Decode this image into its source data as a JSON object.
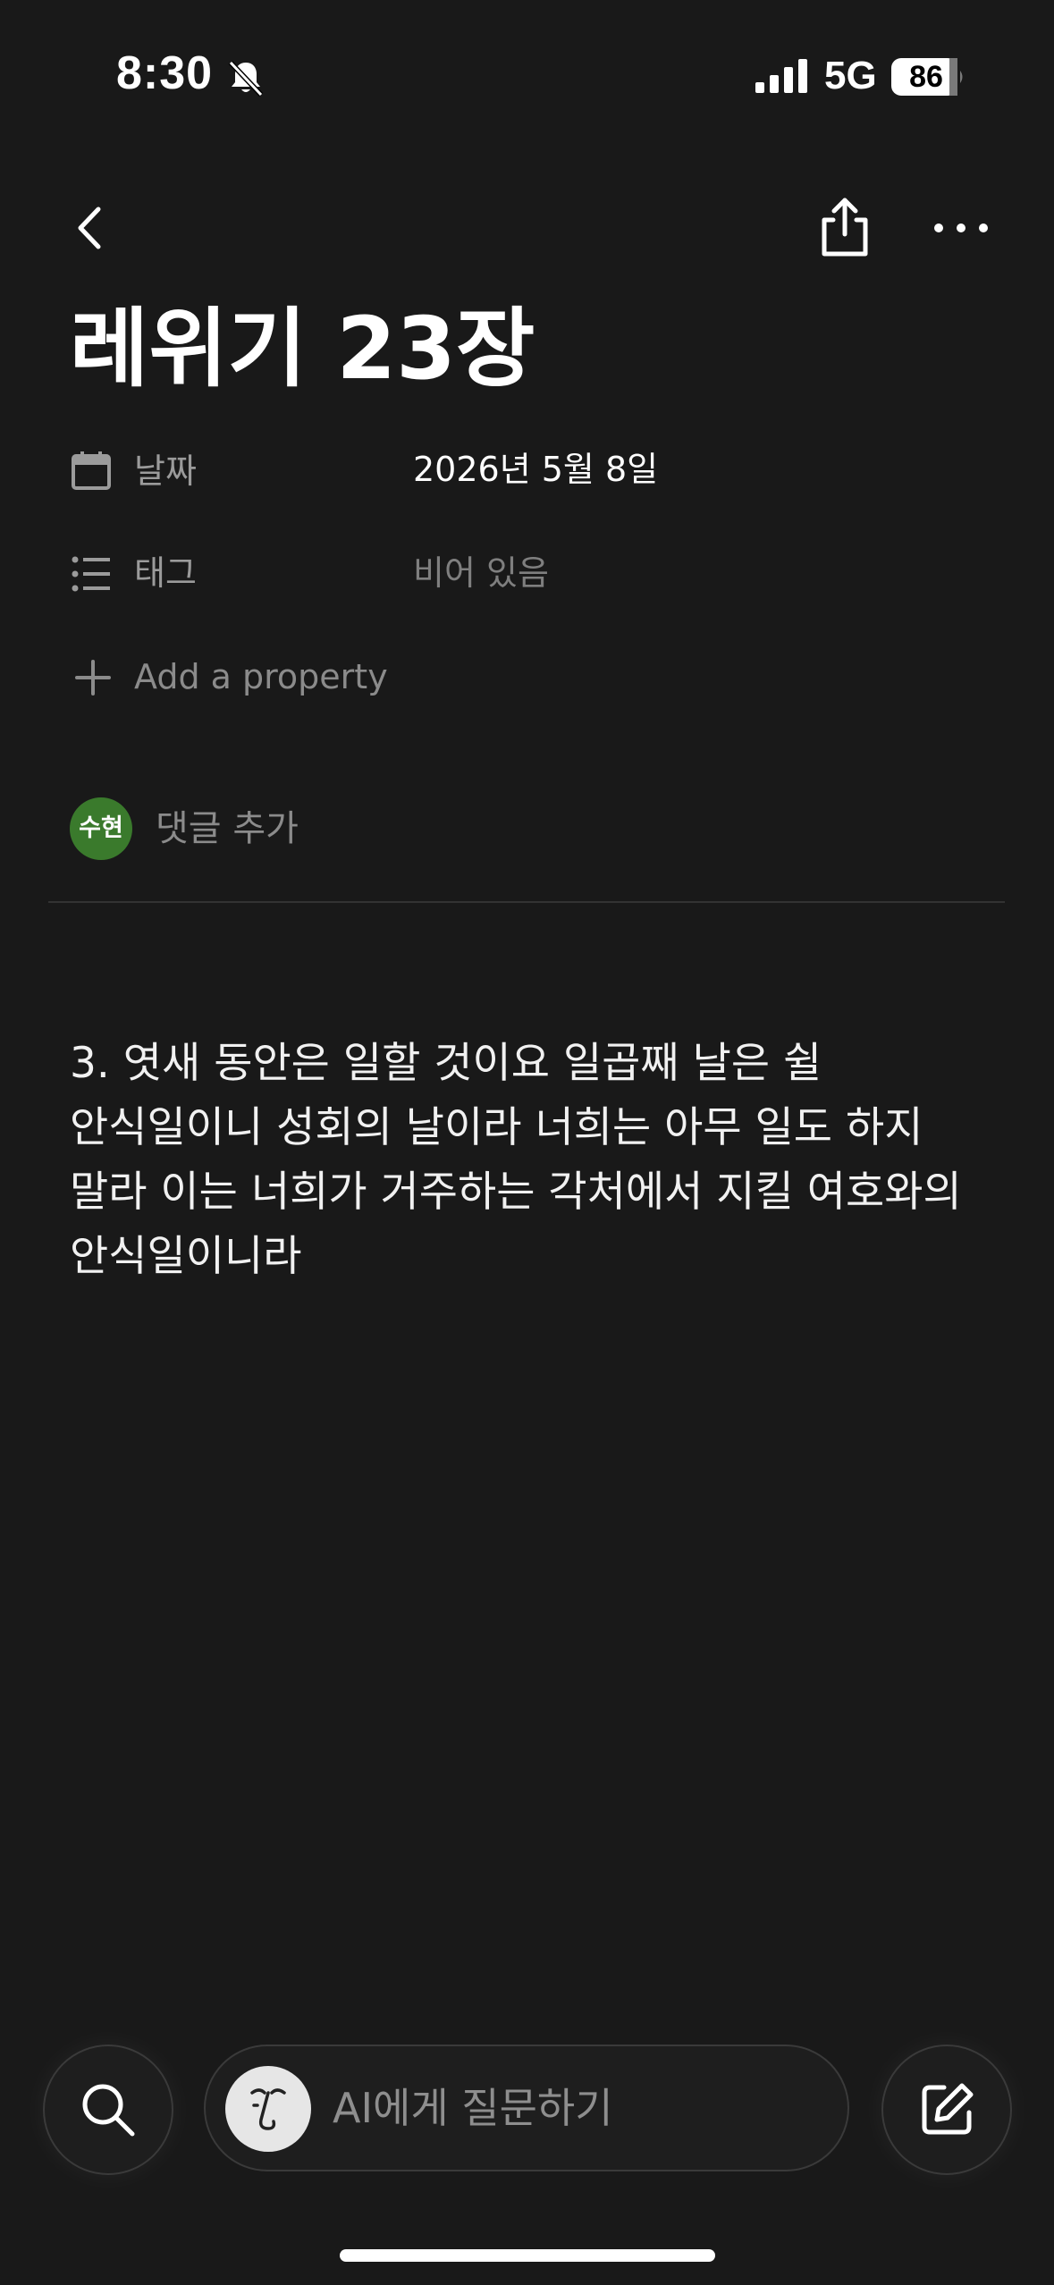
{
  "status_bar": {
    "time": "8:30",
    "network": "5G",
    "battery": "86",
    "icons": [
      "bell-slash-icon",
      "cellular-signal-icon",
      "battery-icon"
    ]
  },
  "nav": {
    "icons": [
      "chevron-left-icon",
      "share-icon",
      "more-horizontal-icon"
    ]
  },
  "page": {
    "title": "레위기 23장"
  },
  "properties": [
    {
      "icon": "calendar-icon",
      "label": "날짜",
      "value": "2026년 5월 8일",
      "value_color": "#ffffff"
    },
    {
      "icon": "list-icon",
      "label": "태그",
      "value": "비어 있음",
      "value_color": "#7f7f7f"
    }
  ],
  "add_property": {
    "icon": "plus-icon",
    "label": "Add a property"
  },
  "comment": {
    "avatar_text": "수현",
    "avatar_color": "#3a7a2c",
    "placeholder": "댓글 추가"
  },
  "content": {
    "paragraph": "3. 엿새 동안은 일할 것이요 일곱째 날은 쉴 안식일이니 성회의 날이라 너희는 아무 일도 하지 말라 이는 너희가 거주하는 각처에서 지킬 여호와의 안식일이니라"
  },
  "bottom_bar": {
    "ai_placeholder": "AI에게 질문하기",
    "icons": [
      "search-icon",
      "ai-face-icon",
      "compose-icon"
    ]
  },
  "colors": {
    "background": "#191919",
    "text": "#ffffff",
    "muted": "#9b9b9b"
  }
}
